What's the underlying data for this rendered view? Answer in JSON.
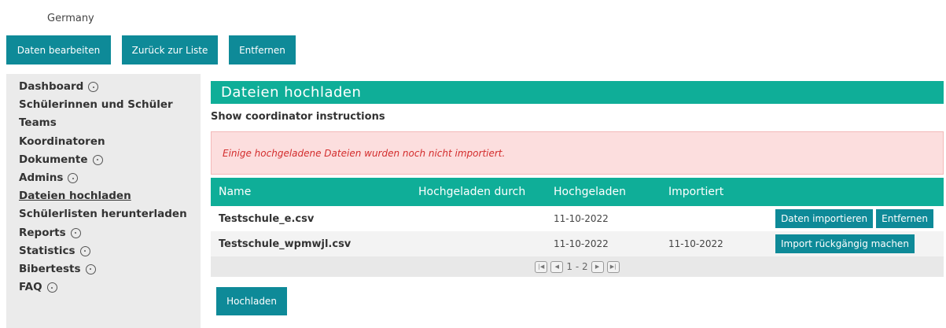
{
  "header": {
    "country": "Germany",
    "buttons": {
      "edit": "Daten bearbeiten",
      "back": "Zurück zur Liste",
      "remove": "Entfernen"
    }
  },
  "sidebar": {
    "items": [
      {
        "label": "Dashboard",
        "expandable": true
      },
      {
        "label": "Schülerinnen und Schüler",
        "expandable": false
      },
      {
        "label": "Teams",
        "expandable": false
      },
      {
        "label": "Koordinatoren",
        "expandable": false
      },
      {
        "label": "Dokumente",
        "expandable": true
      },
      {
        "label": "Admins",
        "expandable": true
      },
      {
        "label": "Dateien hochladen",
        "expandable": false,
        "active": true
      },
      {
        "label": "Schülerlisten herunterladen",
        "expandable": false
      },
      {
        "label": "Reports",
        "expandable": true
      },
      {
        "label": "Statistics",
        "expandable": true
      },
      {
        "label": "Bibertests",
        "expandable": true
      },
      {
        "label": "FAQ",
        "expandable": true
      }
    ]
  },
  "main": {
    "title": "Dateien hochladen",
    "show_instructions": "Show coordinator instructions",
    "alert": "Einige hochgeladene Dateien wurden noch nicht importiert.",
    "table": {
      "columns": [
        "Name",
        "Hochgeladen durch",
        "Hochgeladen",
        "Importiert"
      ],
      "rows": [
        {
          "name": "Testschule_e.csv",
          "uploaded_by": "",
          "uploaded": "11-10-2022",
          "imported": "",
          "actions": [
            "Daten importieren",
            "Entfernen"
          ]
        },
        {
          "name": "Testschule_wpmwjl.csv",
          "uploaded_by": "",
          "uploaded": "11-10-2022",
          "imported": "11-10-2022",
          "actions": [
            "Import rückgängig machen"
          ]
        }
      ],
      "pagination": {
        "range": "1 - 2"
      }
    },
    "upload_button": "Hochladen"
  },
  "colors": {
    "accent": "#0fae98",
    "button": "#0e8a98",
    "alert_bg": "#fcdede",
    "alert_text": "#d32c2c",
    "sidebar_bg": "#ebebeb"
  },
  "icons": {
    "expand": "circle-dot-icon",
    "pager_first": "first-page-icon",
    "pager_prev": "prev-page-icon",
    "pager_next": "next-page-icon",
    "pager_last": "last-page-icon"
  }
}
